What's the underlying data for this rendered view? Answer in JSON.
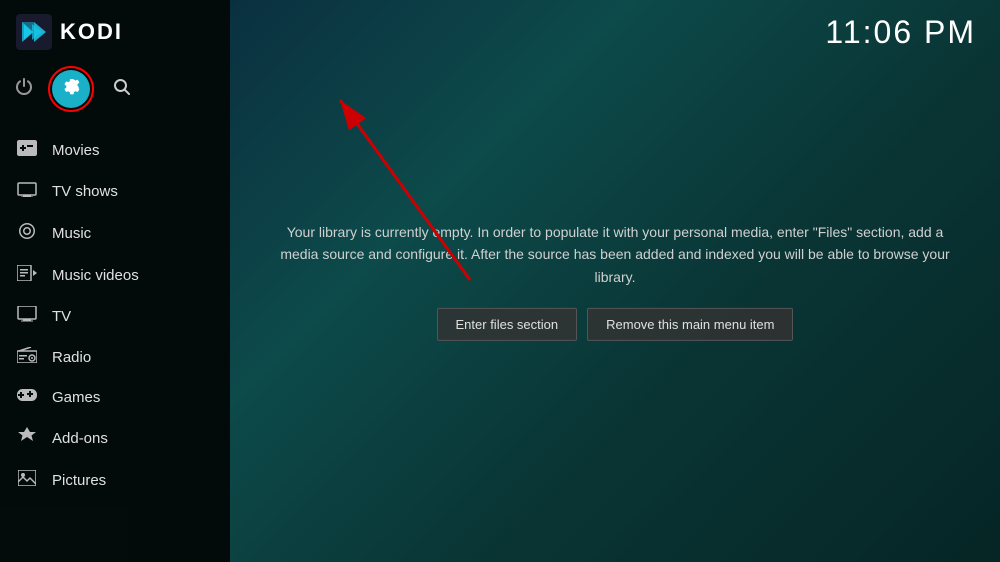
{
  "app": {
    "title": "KODI"
  },
  "time": "11:06 PM",
  "toolbar": {
    "power_icon": "⏻",
    "settings_icon": "⚙",
    "search_icon": "🔍"
  },
  "nav": {
    "items": [
      {
        "id": "movies",
        "label": "Movies",
        "icon": "👥"
      },
      {
        "id": "tv-shows",
        "label": "TV shows",
        "icon": "🖥"
      },
      {
        "id": "music",
        "label": "Music",
        "icon": "🎧"
      },
      {
        "id": "music-videos",
        "label": "Music videos",
        "icon": "🎬"
      },
      {
        "id": "tv",
        "label": "TV",
        "icon": "📺"
      },
      {
        "id": "radio",
        "label": "Radio",
        "icon": "📻"
      },
      {
        "id": "games",
        "label": "Games",
        "icon": "🎮"
      },
      {
        "id": "add-ons",
        "label": "Add-ons",
        "icon": "🎁"
      },
      {
        "id": "pictures",
        "label": "Pictures",
        "icon": "🖼"
      }
    ]
  },
  "main": {
    "info_text": "Your library is currently empty. In order to populate it with your personal media, enter \"Files\" section, add a media source and configure it. After the source has been added and indexed you will be able to browse your library.",
    "enter_files_btn": "Enter files section",
    "remove_menu_btn": "Remove this main menu item"
  }
}
